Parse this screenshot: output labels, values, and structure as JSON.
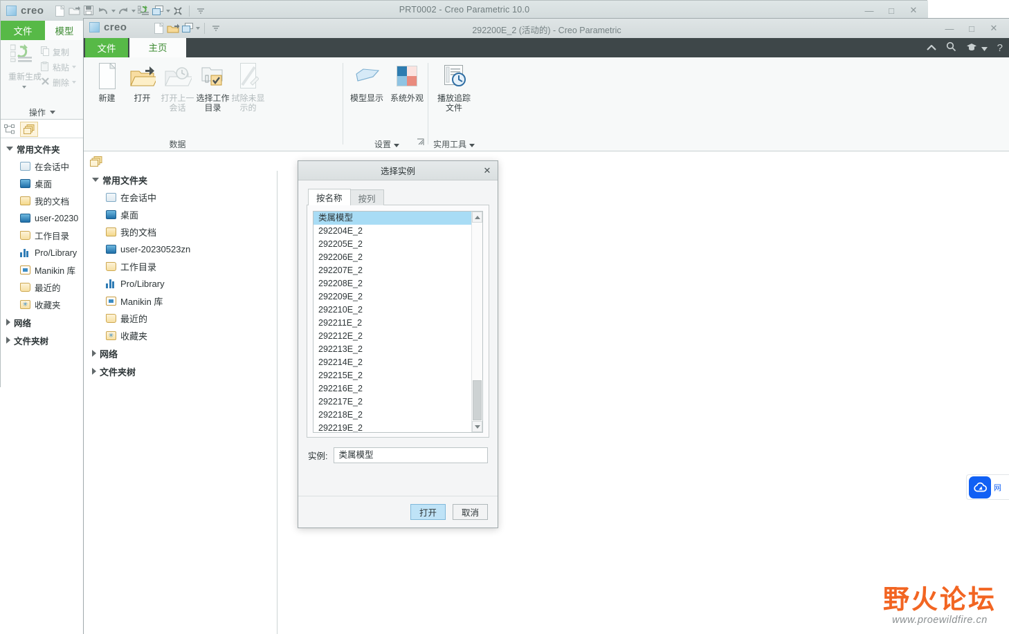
{
  "background_window": {
    "brand": "creo",
    "title": "PRT0002 - Creo Parametric 10.0",
    "quick_access": [
      {
        "name": "new-icon",
        "label": "新建"
      },
      {
        "name": "open-icon",
        "label": "打开"
      },
      {
        "name": "save-icon",
        "label": "保存"
      },
      {
        "name": "undo-icon",
        "label": "撤消"
      },
      {
        "name": "redo-icon",
        "label": "重做"
      },
      {
        "name": "regenerate-icon",
        "label": "重新生成"
      },
      {
        "name": "window-icon",
        "label": "窗口"
      },
      {
        "name": "close-window-icon",
        "label": "关闭"
      },
      {
        "name": "qat-dropdown-icon",
        "label": "自定义快速访问工具栏"
      }
    ],
    "window_controls": {
      "minimize": "—",
      "maximize": "□",
      "close": "✕"
    },
    "ribbon": {
      "tab_file": "文件",
      "tab_model": "模型",
      "regenerate": "重新生成",
      "copy": "复制",
      "paste": "粘贴",
      "delete": "删除",
      "group_label": "操作"
    },
    "tree": {
      "root": "常用文件夹",
      "items": [
        {
          "icon": "monitor-icon",
          "label": "在会话中"
        },
        {
          "icon": "desktop-icon",
          "label": "桌面"
        },
        {
          "icon": "documents-icon",
          "label": "我的文档"
        },
        {
          "icon": "computer-icon",
          "label": "user-20230"
        },
        {
          "icon": "working-directory-icon",
          "label": "工作目录"
        },
        {
          "icon": "library-icon",
          "label": "Pro/Library"
        },
        {
          "icon": "manikin-icon",
          "label": "Manikin 库"
        },
        {
          "icon": "recent-icon",
          "label": "最近的"
        },
        {
          "icon": "favorites-icon",
          "label": "收藏夹"
        }
      ],
      "network": "网络",
      "folder_tree": "文件夹树"
    }
  },
  "foreground_window": {
    "brand": "creo",
    "title": "292200E_2 (活动的) - Creo Parametric",
    "quick_access": [
      {
        "name": "new-icon",
        "label": "新建"
      },
      {
        "name": "open-icon",
        "label": "打开"
      },
      {
        "name": "window-icon",
        "label": "窗口"
      },
      {
        "name": "window-dropdown-icon",
        "label": "窗口下拉"
      },
      {
        "name": "qat-dropdown-icon",
        "label": "自定义快速访问工具栏"
      }
    ],
    "window_controls": {
      "minimize": "—",
      "maximize": "□",
      "close": "✕"
    },
    "tabs": {
      "file": "文件",
      "home": "主页"
    },
    "ribbon_tools": [
      {
        "name": "collapse-ribbon-icon",
        "glyph": "⌃"
      },
      {
        "name": "search-icon",
        "glyph": "⌕"
      },
      {
        "name": "learning-icon",
        "glyph": "🎓"
      },
      {
        "name": "learning-dropdown-icon",
        "glyph": "▾"
      },
      {
        "name": "help-icon",
        "glyph": "?"
      }
    ],
    "ribbon": {
      "groups": [
        {
          "name": "data",
          "label": "数据",
          "buttons": [
            {
              "name": "new-button",
              "label": "新建",
              "icon": "new-page-icon",
              "disabled": false
            },
            {
              "name": "open-button",
              "label": "打开",
              "icon": "open-folder-icon",
              "disabled": false
            },
            {
              "name": "open-last-session-button",
              "label": "打开上一\n会话",
              "icon": "open-last-session-icon",
              "disabled": true
            },
            {
              "name": "select-working-directory-button",
              "label": "选择工作\n目录",
              "icon": "select-working-dir-icon",
              "disabled": false
            },
            {
              "name": "erase-not-displayed-button",
              "label": "拭除未显\n示的",
              "icon": "erase-icon",
              "disabled": true
            }
          ]
        },
        {
          "name": "settings",
          "label": "设置",
          "has_dropdown": true,
          "has_launcher": true,
          "buttons": [
            {
              "name": "model-display-button",
              "label": "模型显示",
              "icon": "model-display-icon",
              "disabled": false
            },
            {
              "name": "system-appearance-button",
              "label": "系统外观",
              "icon": "system-appearance-icon",
              "disabled": false
            }
          ]
        },
        {
          "name": "utilities",
          "label": "实用工具",
          "has_dropdown": true,
          "buttons": [
            {
              "name": "play-trail-file-button",
              "label": "播放追踪\n文件",
              "icon": "play-trail-file-icon",
              "disabled": false
            }
          ]
        }
      ]
    },
    "navigator": {
      "panel_icon": "folders-icon",
      "root": "常用文件夹",
      "items": [
        {
          "icon": "monitor-icon",
          "label": "在会话中"
        },
        {
          "icon": "desktop-icon",
          "label": "桌面"
        },
        {
          "icon": "documents-icon",
          "label": "我的文档"
        },
        {
          "icon": "computer-icon",
          "label": "user-20230523zn"
        },
        {
          "icon": "working-directory-icon",
          "label": "工作目录"
        },
        {
          "icon": "library-icon",
          "label": "Pro/Library"
        },
        {
          "icon": "manikin-icon",
          "label": "Manikin 库"
        },
        {
          "icon": "recent-icon",
          "label": "最近的"
        },
        {
          "icon": "favorites-icon",
          "label": "收藏夹"
        }
      ],
      "network": "网络",
      "folder_tree": "文件夹树"
    }
  },
  "dialog": {
    "title": "选择实例",
    "close_glyph": "✕",
    "tabs": [
      {
        "name": "by-name",
        "label": "按名称",
        "active": true
      },
      {
        "name": "by-column",
        "label": "按列",
        "active": false
      }
    ],
    "list": {
      "selected_index": 0,
      "rows": [
        "类属模型",
        "292204E_2",
        "292205E_2",
        "292206E_2",
        "292207E_2",
        "292208E_2",
        "292209E_2",
        "292210E_2",
        "292211E_2",
        "292212E_2",
        "292213E_2",
        "292214E_2",
        "292215E_2",
        "292216E_2",
        "292217E_2",
        "292218E_2",
        "292219E_2"
      ],
      "scrollbar": {
        "up_glyph": "▲",
        "down_glyph": "▼"
      }
    },
    "instance_field": {
      "label": "实例:",
      "value": "类属模型",
      "placeholder": ""
    },
    "buttons": [
      {
        "name": "open-button",
        "label": "打开",
        "primary": true
      },
      {
        "name": "cancel-button",
        "label": "取消",
        "primary": false
      }
    ]
  },
  "cloud_widget": {
    "icon": "cloud-icon",
    "label": "网",
    "color": "#1160f4"
  },
  "watermark": {
    "title": "野火论坛",
    "url": "www.proewildfire.cn",
    "color": "#f26522"
  }
}
